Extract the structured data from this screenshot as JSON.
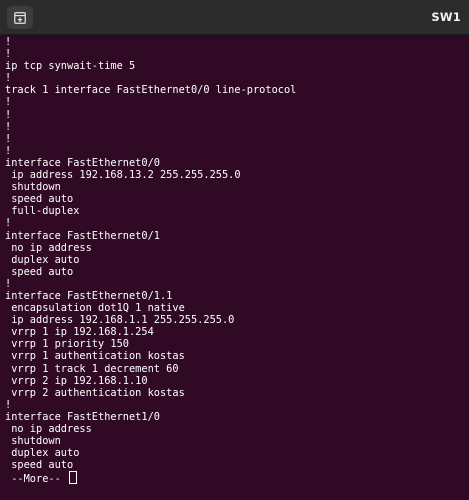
{
  "window": {
    "title": "SW1",
    "new_tab_icon": "new-tab-icon"
  },
  "terminal": {
    "lines": [
      "!",
      "!",
      "ip tcp synwait-time 5",
      "!",
      "track 1 interface FastEthernet0/0 line-protocol",
      "!",
      "!",
      "!",
      "!",
      "!",
      "interface FastEthernet0/0",
      " ip address 192.168.13.2 255.255.255.0",
      " shutdown",
      " speed auto",
      " full-duplex",
      "!",
      "interface FastEthernet0/1",
      " no ip address",
      " duplex auto",
      " speed auto",
      "!",
      "interface FastEthernet0/1.1",
      " encapsulation dot1Q 1 native",
      " ip address 192.168.1.1 255.255.255.0",
      " vrrp 1 ip 192.168.1.254",
      " vrrp 1 priority 150",
      " vrrp 1 authentication kostas",
      " vrrp 1 track 1 decrement 60",
      " vrrp 2 ip 192.168.1.10",
      " vrrp 2 authentication kostas",
      "!",
      "interface FastEthernet1/0",
      " no ip address",
      " shutdown",
      " duplex auto",
      " speed auto"
    ],
    "more_prompt": " --More-- "
  }
}
